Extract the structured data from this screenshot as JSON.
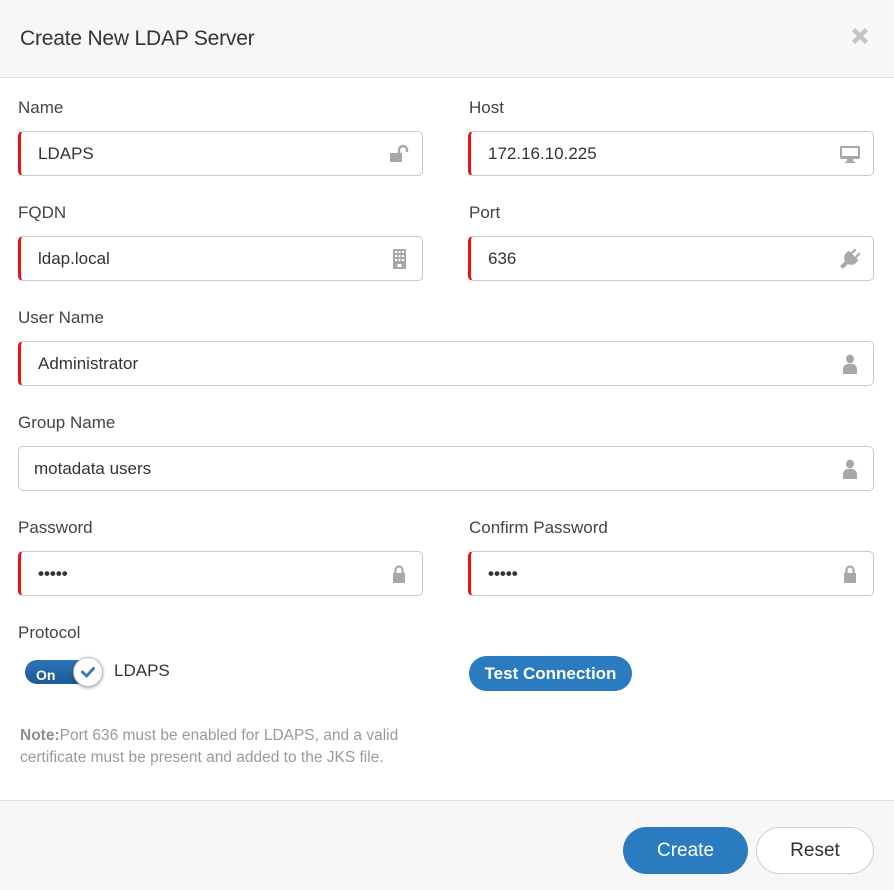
{
  "dialog": {
    "title": "Create New LDAP Server",
    "close_icon": "close-icon"
  },
  "fields": {
    "name": {
      "label": "Name",
      "value": "LDAPS",
      "icon": "unlock-icon",
      "required": true
    },
    "host": {
      "label": "Host",
      "value": "172.16.10.225",
      "icon": "desktop-icon",
      "required": true
    },
    "fqdn": {
      "label": "FQDN",
      "value": "ldap.local",
      "icon": "building-icon",
      "required": true
    },
    "port": {
      "label": "Port",
      "value": "636",
      "icon": "plug-icon",
      "required": true
    },
    "user_name": {
      "label": "User Name",
      "value": "Administrator",
      "icon": "user-icon",
      "required": true
    },
    "group_name": {
      "label": "Group Name",
      "value": "motadata users",
      "icon": "user-icon",
      "required": false
    },
    "password": {
      "label": "Password",
      "value": "•••••",
      "icon": "lock-icon",
      "required": true
    },
    "confirm_password": {
      "label": "Confirm Password",
      "value": "•••••",
      "icon": "lock-icon",
      "required": true
    }
  },
  "protocol": {
    "label": "Protocol",
    "toggle_state": "On",
    "toggle_on": true,
    "option_label": "LDAPS"
  },
  "test_connection_label": "Test Connection",
  "note": {
    "prefix": "Note:",
    "text": "Port 636 must be enabled for LDAPS, and a valid certificate must be present and added to the JKS file."
  },
  "footer": {
    "create_label": "Create",
    "reset_label": "Reset"
  },
  "colors": {
    "primary": "#2a7bc0",
    "required_marker": "#ee1111",
    "icon_gray": "#a8a8a8"
  }
}
